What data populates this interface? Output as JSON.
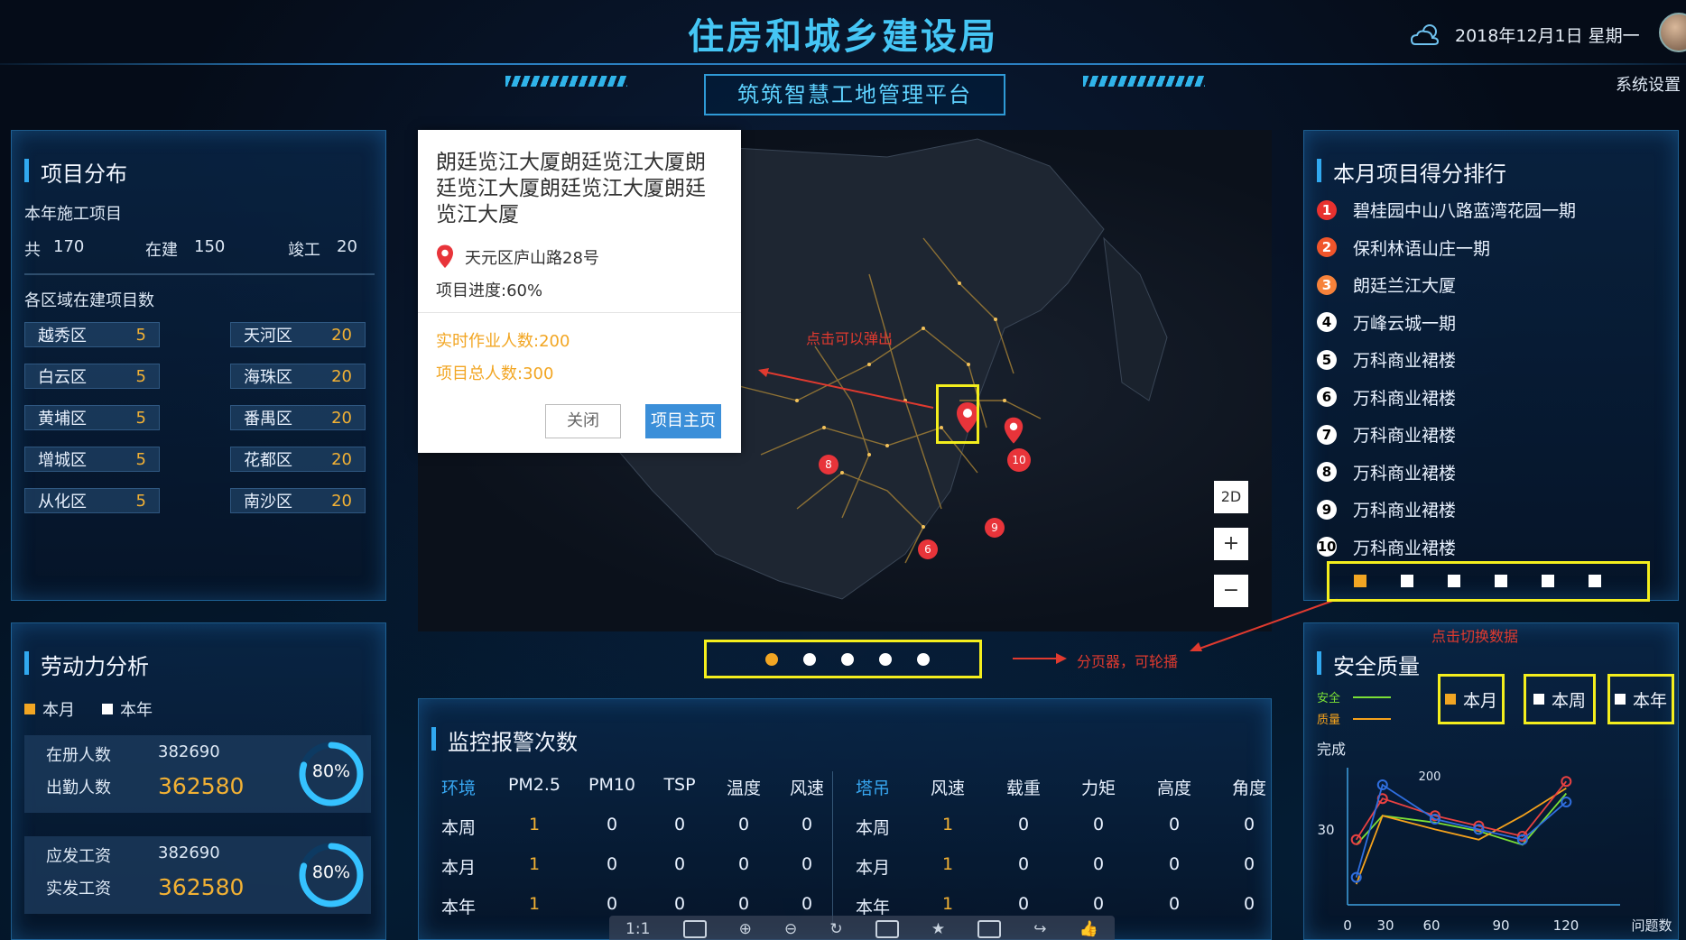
{
  "header": {
    "title": "住房和城乡建设局",
    "subtitle": "筑筑智慧工地管理平台",
    "date": "2018年12月1日  星期一",
    "settings": "系统设置"
  },
  "project_dist": {
    "title": "项目分布",
    "year_label": "本年施工项目",
    "total_label": "共",
    "total": "170",
    "building_label": "在建",
    "building": "150",
    "done_label": "竣工",
    "done": "20",
    "area_label": "各区域在建项目数",
    "districts": [
      {
        "name": "越秀区",
        "value": "5"
      },
      {
        "name": "天河区",
        "value": "20"
      },
      {
        "name": "白云区",
        "value": "5"
      },
      {
        "name": "海珠区",
        "value": "20"
      },
      {
        "name": "黄埔区",
        "value": "5"
      },
      {
        "name": "番禺区",
        "value": "20"
      },
      {
        "name": "增城区",
        "value": "5"
      },
      {
        "name": "花都区",
        "value": "20"
      },
      {
        "name": "从化区",
        "value": "5"
      },
      {
        "name": "南沙区",
        "value": "20"
      }
    ]
  },
  "labor": {
    "title": "劳动力分析",
    "legend_month": "本月",
    "legend_year": "本年",
    "registered_label": "在册人数",
    "registered": "382690",
    "attendance_label": "出勤人数",
    "attendance": "362580",
    "ring1": "80%",
    "ring1_fraction": 0.8,
    "payable_label": "应发工资",
    "payable": "382690",
    "paid_label": "实发工资",
    "paid": "362580",
    "ring2": "80%",
    "ring2_fraction": 0.8
  },
  "popup": {
    "title": "朗廷览江大厦朗廷览江大厦朗廷览江大厦朗廷览江大厦朗廷览江大厦",
    "address": "天元区庐山路28号",
    "progress": "项目进度:60%",
    "workers_now": "实时作业人数:200",
    "workers_total": "项目总人数:300",
    "close": "关闭",
    "home": "项目主页"
  },
  "map": {
    "annot_click": "点击可以弹出",
    "annot_pager": "分页器，可轮播",
    "annot_switch": "点击切换数据",
    "ctrl_2d": "2D",
    "ctrl_plus": "+",
    "ctrl_minus": "−",
    "marker_labels": [
      "8",
      "10",
      "9",
      "6"
    ]
  },
  "ranking": {
    "title": "本月项目得分排行",
    "items": [
      {
        "rank": "1",
        "name": "碧桂园中山八路蓝湾花园一期",
        "color": "#e8312f"
      },
      {
        "rank": "2",
        "name": "保利林语山庄一期",
        "color": "#f0552b"
      },
      {
        "rank": "3",
        "name": "朗廷兰江大厦",
        "color": "#f7823a"
      },
      {
        "rank": "4",
        "name": "万峰云城一期",
        "color": "#ffffff"
      },
      {
        "rank": "5",
        "name": "万科商业裙楼",
        "color": "#ffffff"
      },
      {
        "rank": "6",
        "name": "万科商业裙楼",
        "color": "#ffffff"
      },
      {
        "rank": "7",
        "name": "万科商业裙楼",
        "color": "#ffffff"
      },
      {
        "rank": "8",
        "name": "万科商业裙楼",
        "color": "#ffffff"
      },
      {
        "rank": "9",
        "name": "万科商业裙楼",
        "color": "#ffffff"
      },
      {
        "rank": "10",
        "name": "万科商业裙楼",
        "color": "#ffffff"
      }
    ]
  },
  "monitor": {
    "title": "监控报警次数",
    "env_headers": [
      "环境",
      "PM2.5",
      "PM10",
      "TSP",
      "温度",
      "风速"
    ],
    "crane_headers": [
      "塔吊",
      "风速",
      "载重",
      "力矩",
      "高度",
      "角度"
    ],
    "rows": [
      {
        "label": "本周",
        "env": [
          "1",
          "0",
          "0",
          "0",
          "0"
        ],
        "crane_label": "本周",
        "crane": [
          "1",
          "0",
          "0",
          "0",
          "0"
        ]
      },
      {
        "label": "本月",
        "env": [
          "1",
          "0",
          "0",
          "0",
          "0"
        ],
        "crane_label": "本月",
        "crane": [
          "1",
          "0",
          "0",
          "0",
          "0"
        ]
      },
      {
        "label": "本年",
        "env": [
          "1",
          "0",
          "0",
          "0",
          "0"
        ],
        "crane_label": "本年",
        "crane": [
          "1",
          "0",
          "0",
          "0",
          "0"
        ]
      }
    ]
  },
  "toolbar": {
    "zoom": "1:1"
  },
  "safety": {
    "title": "安全质量",
    "legend_safety": "安全",
    "legend_quality": "质量",
    "btn_month": "本月",
    "btn_week": "本周",
    "btn_year": "本年",
    "ylabel": "完成",
    "xlabel": "问题数",
    "peak_label": "200"
  },
  "chart_data": {
    "type": "line",
    "title": "",
    "xlabel": "问题数",
    "ylabel": "完成",
    "x_ticks": [
      "0",
      "30",
      "60",
      "90",
      "120"
    ],
    "y_ticks": [
      "30"
    ],
    "series": [
      {
        "name": "安全",
        "color": "#7be036",
        "x": [
          5,
          20,
          50,
          75,
          100,
          125
        ],
        "y": [
          35,
          52,
          48,
          43,
          35,
          65
        ]
      },
      {
        "name": "质量",
        "color": "#f5a21c",
        "x": [
          5,
          20,
          50,
          75,
          100,
          125
        ],
        "y": [
          12,
          52,
          44,
          38,
          52,
          68
        ]
      },
      {
        "name": "",
        "color": "#e94141",
        "x": [
          5,
          20,
          50,
          75,
          100,
          125
        ],
        "y": [
          38,
          62,
          52,
          46,
          40,
          72
        ]
      },
      {
        "name": "",
        "color": "#2f6fe0",
        "x": [
          5,
          20,
          50,
          75,
          100,
          125
        ],
        "y": [
          16,
          70,
          50,
          44,
          38,
          60
        ]
      }
    ]
  }
}
